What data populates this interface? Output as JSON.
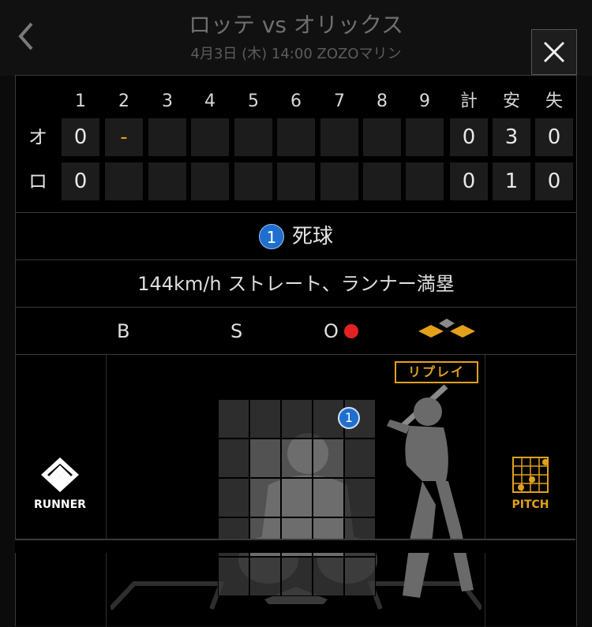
{
  "header": {
    "title": "ロッテ vs オリックス",
    "subtitle": "4月3日 (木) 14:00 ZOZOマリン"
  },
  "scoreboard": {
    "innings": [
      "1",
      "2",
      "3",
      "4",
      "5",
      "6",
      "7",
      "8",
      "9"
    ],
    "totals_headers": [
      "計",
      "安",
      "失"
    ],
    "teams": [
      {
        "label": "オ",
        "innings": [
          "0",
          "-",
          "",
          "",
          "",
          "",
          "",
          "",
          ""
        ],
        "totals": [
          "0",
          "3",
          "0"
        ]
      },
      {
        "label": "ロ",
        "innings": [
          "0",
          "",
          "",
          "",
          "",
          "",
          "",
          "",
          ""
        ],
        "totals": [
          "0",
          "1",
          "0"
        ]
      }
    ]
  },
  "play": {
    "pitch_number": "1",
    "result": "死球",
    "description": "144km/h ストレート、ランナー満塁"
  },
  "count": {
    "ball_label": "B",
    "strike_label": "S",
    "out_label": "O",
    "outs": 1,
    "bases_loaded": true
  },
  "panel": {
    "runner_label": "RUNNER",
    "pitch_label": "PITCH",
    "replay_label": "リプレイ",
    "pitch_marker": "1"
  },
  "colors": {
    "accent": "#e3a11a",
    "badge": "#1f6fcf",
    "out": "#e52222"
  }
}
